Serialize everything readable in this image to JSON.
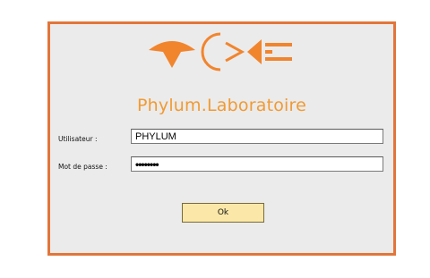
{
  "app": {
    "title": "Phylum.Laboratoire"
  },
  "login": {
    "user_label": "Utilisateur :",
    "user_value": "PHYLUM",
    "password_label": "Mot de passe :",
    "password_value": "12345678",
    "ok_label": "Ok"
  },
  "colors": {
    "accent": "#e2753a",
    "title": "#f09a33",
    "panel": "#ecebeb",
    "button": "#fbe8a8"
  },
  "icons": {
    "logo": "phylum-logo"
  }
}
